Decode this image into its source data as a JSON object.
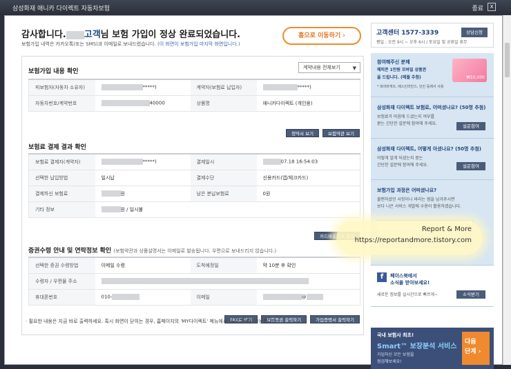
{
  "window": {
    "title": "삼성화재 애니카 다이렉트 자동차보험",
    "close_label": "종료",
    "close_symbol": "x"
  },
  "header": {
    "title_prefix": "감사합니다.",
    "title_name_suffix": "고객",
    "title_rest_hl": "님 보험 가입이 정상 완료되었습니다.",
    "subtitle": "보험가입 내역은 카카오톡(또는 SMS)과 이메일로 보내드렸습니다.",
    "subtitle_note": "(이 화면이 보험가입 마지막 화면입니다.)",
    "home_button": "홈으로 이동하기 ›"
  },
  "section1": {
    "title": "보험가입 내용 확인",
    "dropdown_value": "계약내용 전체보기",
    "rows": [
      {
        "l1": "피보험자(자동차 소유자)",
        "v1": "*****)",
        "l2": "계약자(보험료 납입자)",
        "v2": "*****)"
      },
      {
        "l1": "자동차번호/계약번호",
        "v1": "40000",
        "l2": "상품명",
        "v2": "애니카다이렉트 (개인용)"
      }
    ],
    "buttons": [
      "청약서 보기",
      "보험약관 보기"
    ]
  },
  "section2": {
    "title": "보험료 결제 결과 확인",
    "rows": [
      {
        "l1": "보험료 결제자(계약자)",
        "v1": "*****)",
        "l2": "결제일시",
        "v2": "07.18 16:54:03"
      },
      {
        "l1": "선택한 납입방법",
        "v1": "일시납",
        "l2": "결제수단",
        "v2": "신용카드(앱/체크카드)"
      },
      {
        "l1": "결제하신 보험료",
        "v1": "원",
        "l2": "남은 분납보험료",
        "v2": "0원"
      },
      {
        "l1": "기타 정보",
        "v1": "원 / 일시불"
      }
    ],
    "buttons": [
      "카드매출전표 출력"
    ]
  },
  "section3": {
    "title": "증권수령 안내 및 연락정보 확인",
    "subtitle": "(보험약관과 상품설명서는 이메일로 발송됩니다. 우편으로 보내드리지 않습니다.)",
    "rows": [
      {
        "l1": "선택한 증권 수령방법",
        "v1": "이메일 수령",
        "l2": "도착예정일",
        "v2": "약 10분 후 확인"
      },
      {
        "l1": "수령자 / 우편물 주소"
      },
      {
        "l1": "휴대폰번호",
        "v1": "010-",
        "l2": "이메일",
        "v2": "@"
      }
    ],
    "buttons": [
      "FAX로 받기",
      "보험증권 출력하기",
      "가입증명서 출력하기"
    ]
  },
  "footer_note": "· 필요한 내용은 지금 바로 출력하세요. 혹시 화면이 닫히는 경우, 홈페이지의 'MY다이렉트' 메뉴에서 다시 출력이 가능합니다.",
  "sidebar": {
    "call_center": {
      "label": "고객센터 1577-3339",
      "hours": "평일 : 오전 9시 ~ 오후 6시 / 토요일 및 공휴일 휴무",
      "button": "상담신청"
    },
    "cards": [
      {
        "title": "참여해주신 분께",
        "lines": [
          "해피콘 1만원 모바일 상품권",
          "을 드립니다. (매월 추첨)",
          "* 파리바게뜨, 베스킨라빈스, 던킨 등에서 사용"
        ],
        "gift_amount": "₩10,000"
      },
      {
        "title": "삼성화재 다이렉트 보험료, 어떠셨나요? (50명 추첨)",
        "lines": [
          "보험료가 마음에 드셨는지 여부를",
          "묻는 간단한 설문에 참여해 주세요."
        ],
        "button": "설문참여"
      },
      {
        "title": "삼성화재 다이렉트, 어떻게 아셨나요? (50명 추첨)",
        "lines": [
          "어떻게 알게 되셨는지 묻는",
          "간단한 설문에 참여해 주세요."
        ],
        "button": "설문참여"
      },
      {
        "title": "보험가입 과정은 어떠셨나요?",
        "lines": [
          "불편하셨던 사항이나 바라는 점을 남겨주시면",
          "보다 나은 서비스 개발에 수용이 활용하겠습니다."
        ]
      },
      {
        "title": "페이스북에서",
        "title2": "소식을 받아보세요!",
        "lines": [
          "새로운 정보를 실시간으로 빠르게~"
        ],
        "button": "소식받기"
      }
    ],
    "smart": {
      "line1": "국내 보험사 최초!",
      "line2": "Smart™ 보장분석 서비스",
      "line3": "가입하신 모든 보험을",
      "line4": "점검해보세요!",
      "next": [
        "다음",
        "단계 ›"
      ]
    }
  },
  "watermark": {
    "line1": "Report & More",
    "line2": "https://reportandmore.tistory.com"
  }
}
